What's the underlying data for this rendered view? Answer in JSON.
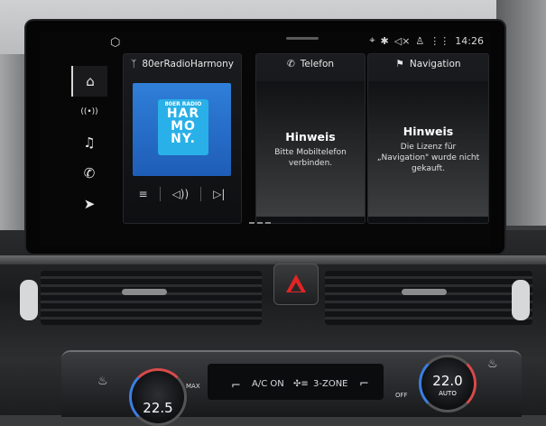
{
  "status_bar": {
    "time": "14:26",
    "icons": [
      "settings-icon",
      "location-icon",
      "bluetooth-icon",
      "mute-icon",
      "user-icon",
      "signal-icon"
    ]
  },
  "sidebar": {
    "items": [
      {
        "name": "home-icon",
        "glyph": "⌂"
      },
      {
        "name": "radio-icon",
        "glyph": "((•))"
      },
      {
        "name": "music-icon",
        "glyph": "♫"
      },
      {
        "name": "phone-icon",
        "glyph": "✆"
      },
      {
        "name": "navigation-icon",
        "glyph": "➤"
      }
    ]
  },
  "radio_tile": {
    "header": "80erRadioHarmony",
    "logo_top": "80ER RADIO",
    "logo_lines": [
      "HAR",
      "MO",
      "NY."
    ],
    "controls": [
      "≡",
      "◁))",
      "▷|"
    ]
  },
  "phone_tile": {
    "header": "Telefon",
    "title": "Hinweis",
    "message": "Bitte Mobiltelefon verbinden."
  },
  "nav_tile": {
    "header": "Navigation",
    "title": "Hinweis",
    "message": "Die Lizenz für „Navigation\" wurde nicht gekauft."
  },
  "climate": {
    "left_temp": "22.5",
    "right_temp": "22.0",
    "ac": "A/C ON",
    "zone": "3-ZONE",
    "max": "MAX",
    "auto": "AUTO",
    "off": "OFF"
  },
  "colors": {
    "hazard": "#e32424",
    "logo_blue": "#1e5db8",
    "logo_light": "#29b0e8"
  }
}
